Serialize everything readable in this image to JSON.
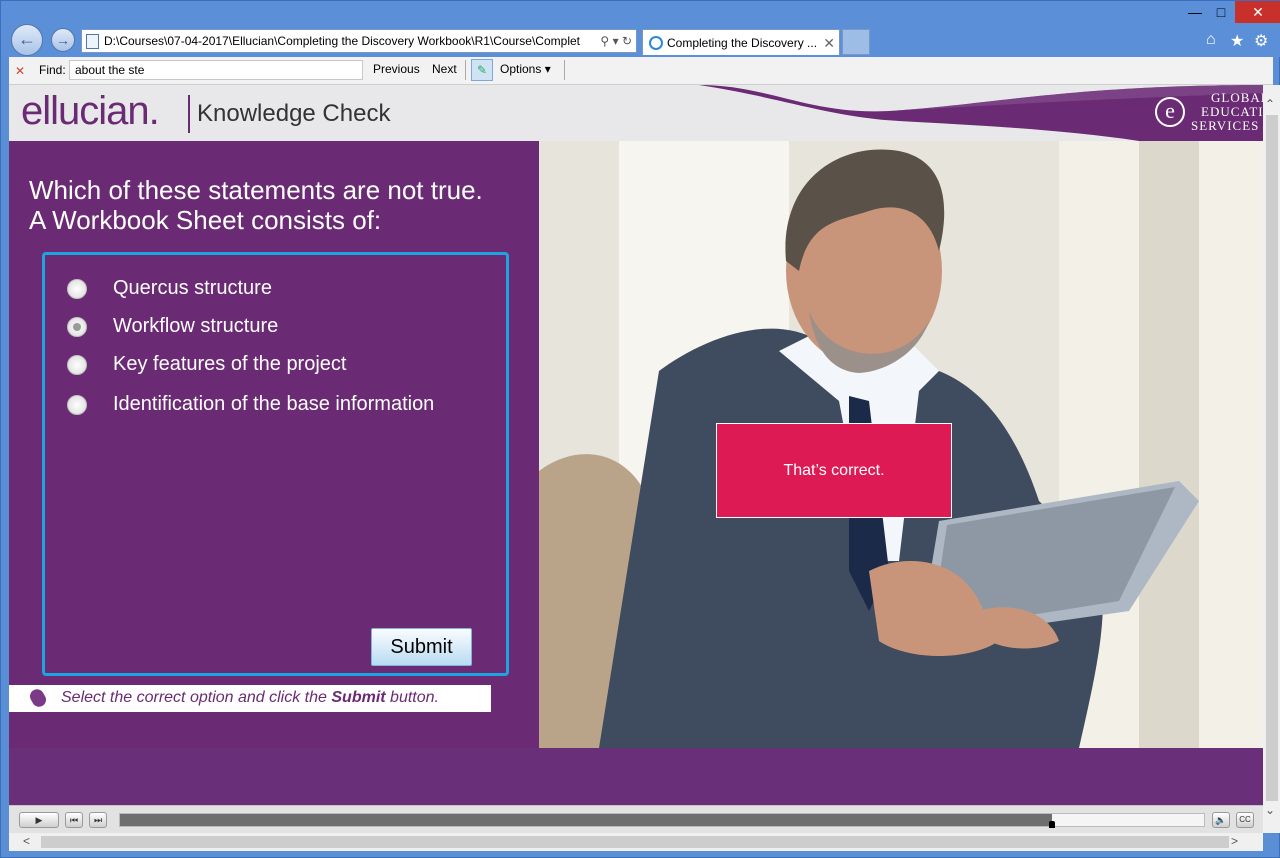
{
  "browser": {
    "address": "D:\\Courses\\07-04-2017\\Ellucian\\Completing the Discovery Workbook\\R1\\Course\\Complet",
    "tab_title": "Completing the Discovery ...",
    "icons": [
      "back-icon",
      "forward-icon",
      "search-icon",
      "refresh-icon",
      "home-icon",
      "star-icon",
      "gear-icon"
    ]
  },
  "findbar": {
    "label": "Find:",
    "query": "about the ste",
    "previous": "Previous",
    "next": "Next",
    "options": "Options"
  },
  "header": {
    "logo": "ellucian.",
    "title": "Knowledge Check",
    "ges_line1": "GLOBAL",
    "ges_line2": "EDUCATION",
    "ges_line3": "SERVICES",
    "ges_mark": "e"
  },
  "question": {
    "line1": "Which of these statements are not true.",
    "line2": "A Workbook Sheet consists of:"
  },
  "options": [
    {
      "label": "Quercus structure",
      "selected": false
    },
    {
      "label": "Workflow structure",
      "selected": true
    },
    {
      "label": "Key features of the project",
      "selected": false
    },
    {
      "label": "Identification of the base information",
      "selected": false
    }
  ],
  "submit_label": "Submit",
  "instruction": {
    "before": "Select the correct option and click the ",
    "emph": "Submit",
    "after": " button."
  },
  "feedback": "That’s correct.",
  "player": {
    "progress": 0.86,
    "cc_label": "CC"
  },
  "colors": {
    "brand_purple": "#6b2a74",
    "accent_blue": "#1ea5e0",
    "feedback_red": "#de1a55"
  }
}
